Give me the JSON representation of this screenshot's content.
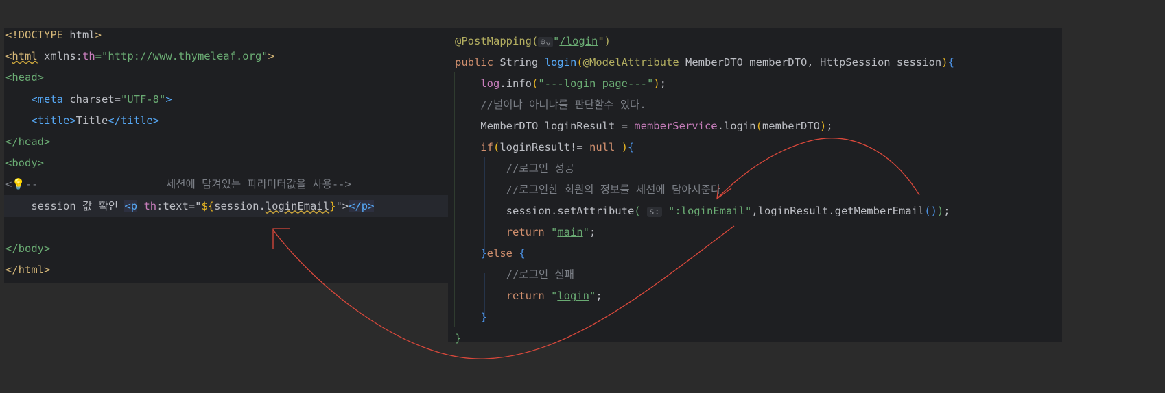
{
  "html_editor": {
    "lines": [
      [
        [
          "<!DOCTYPE ",
          "t-dt"
        ],
        [
          "html",
          "t-txt"
        ],
        [
          ">",
          "t-dt"
        ]
      ],
      [
        [
          "<",
          "t-tag"
        ],
        [
          "html",
          "t-tag t-wv"
        ],
        [
          " xmlns:",
          "t-txt"
        ],
        [
          "th",
          "t-th"
        ],
        [
          "=\"http://www.thymeleaf.org\"",
          "t-str"
        ],
        [
          ">",
          "t-tag"
        ]
      ],
      [
        [
          "<head>",
          "t-tg"
        ]
      ],
      [
        [
          "    ",
          "t-txt"
        ],
        [
          "<meta",
          "t-tb"
        ],
        [
          " charset=",
          "t-txt"
        ],
        [
          "\"UTF-8\"",
          "t-str"
        ],
        [
          ">",
          "t-tb"
        ]
      ],
      [
        [
          "    ",
          "t-txt"
        ],
        [
          "<title>",
          "t-tb"
        ],
        [
          "Title",
          "t-txt"
        ],
        [
          "</title>",
          "t-tb"
        ]
      ],
      [
        [
          "</head>",
          "t-tg"
        ]
      ],
      [
        [
          "<body>",
          "t-tg"
        ]
      ],
      [
        [
          "<",
          "t-cm"
        ],
        [
          "💡",
          "t-br"
        ],
        [
          "--                    세션에 담겨있는 파라미터값을 사용-->",
          "t-cm"
        ]
      ],
      [
        [
          "    session 값 확인 ",
          "t-txt"
        ],
        [
          "<p",
          "t-tb t-boxp"
        ],
        [
          " ",
          "t-txt"
        ],
        [
          "th",
          "t-th"
        ],
        [
          ":text=\"",
          "t-txt"
        ],
        [
          "${",
          "t-br"
        ],
        [
          "session.",
          "t-txt"
        ],
        [
          "loginEmail",
          "t-txt t-wv"
        ],
        [
          "}",
          "t-br"
        ],
        [
          "\">",
          "t-txt"
        ],
        [
          "</p>",
          "t-tb t-boxp"
        ]
      ],
      [
        [
          "",
          "t-txt"
        ]
      ],
      [
        [
          "</body>",
          "t-tg"
        ]
      ],
      [
        [
          "</html>",
          "t-dt"
        ]
      ]
    ]
  },
  "java_editor": {
    "lines": [
      [
        [
          "@PostMapping(",
          "t-an"
        ],
        [
          "⊕⌄",
          "t-hint"
        ],
        [
          "\"",
          "t-str"
        ],
        [
          "/login",
          "t-str t-ul"
        ],
        [
          "\")",
          "t-an"
        ]
      ],
      [
        [
          "public ",
          "t-kw"
        ],
        [
          "String ",
          "t-txt"
        ],
        [
          "login",
          "t-fn"
        ],
        [
          "(",
          "t-br"
        ],
        [
          "@ModelAttribute ",
          "t-an"
        ],
        [
          "MemberDTO memberDTO, HttpSession session",
          "t-txt"
        ],
        [
          ")",
          "t-br"
        ],
        [
          "{",
          "t-bb"
        ]
      ],
      [
        [
          "    ",
          "t-txt"
        ],
        [
          "log",
          "t-fld"
        ],
        [
          ".info",
          "t-txt"
        ],
        [
          "(",
          "t-br"
        ],
        [
          "\"---login page---\"",
          "t-str"
        ],
        [
          ")",
          "t-br"
        ],
        [
          ";",
          "t-txt"
        ]
      ],
      [
        [
          "    //널이냐 아니냐를 판단할수 있다.",
          "t-cm"
        ]
      ],
      [
        [
          "    MemberDTO loginResult = ",
          "t-txt"
        ],
        [
          "memberService",
          "t-fld"
        ],
        [
          ".login",
          "t-txt"
        ],
        [
          "(",
          "t-br"
        ],
        [
          "memberDTO",
          "t-txt"
        ],
        [
          ")",
          "t-br"
        ],
        [
          ";",
          "t-txt"
        ]
      ],
      [
        [
          "    ",
          "t-txt"
        ],
        [
          "if",
          "t-kw"
        ],
        [
          "(",
          "t-br"
        ],
        [
          "loginResult!= ",
          "t-txt"
        ],
        [
          "null",
          "t-kw"
        ],
        [
          " ",
          "t-txt"
        ],
        [
          ")",
          "t-br"
        ],
        [
          "{",
          "t-bb"
        ]
      ],
      [
        [
          "        //로그인 성공",
          "t-cm"
        ]
      ],
      [
        [
          "        //로그인한 회원의 정보를 세션에 담아서준다",
          "t-cm"
        ]
      ],
      [
        [
          "        session.setAttribute",
          "t-txt"
        ],
        [
          "(",
          "t-bg"
        ],
        [
          " ",
          "t-txt"
        ],
        [
          "s:",
          "t-hint"
        ],
        [
          " ",
          "t-txt"
        ],
        [
          "\":loginEmail\"",
          "t-str"
        ],
        [
          ",loginResult.getMemberEmail",
          "t-txt"
        ],
        [
          "()",
          "t-bb"
        ],
        [
          ")",
          "t-bg"
        ],
        [
          ";",
          "t-txt"
        ]
      ],
      [
        [
          "        ",
          "t-txt"
        ],
        [
          "return ",
          "t-kw"
        ],
        [
          "\"",
          "t-str"
        ],
        [
          "main",
          "t-str t-ul"
        ],
        [
          "\"",
          "t-str"
        ],
        [
          ";",
          "t-txt"
        ]
      ],
      [
        [
          "    ",
          "t-txt"
        ],
        [
          "}",
          "t-bb"
        ],
        [
          "else ",
          "t-kw"
        ],
        [
          "{",
          "t-bb"
        ]
      ],
      [
        [
          "        //로그인 실패",
          "t-cm"
        ]
      ],
      [
        [
          "        ",
          "t-txt"
        ],
        [
          "return ",
          "t-kw"
        ],
        [
          "\"",
          "t-str"
        ],
        [
          "login",
          "t-str t-ul"
        ],
        [
          "\"",
          "t-str"
        ],
        [
          ";",
          "t-txt"
        ]
      ],
      [
        [
          "    ",
          "t-txt"
        ],
        [
          "}",
          "t-bb"
        ]
      ],
      [
        [
          "}",
          "t-bg"
        ]
      ]
    ]
  },
  "colors": {
    "background": "#2b2b2b",
    "editor": "#1e1f22",
    "arrow": "#d9483b"
  }
}
